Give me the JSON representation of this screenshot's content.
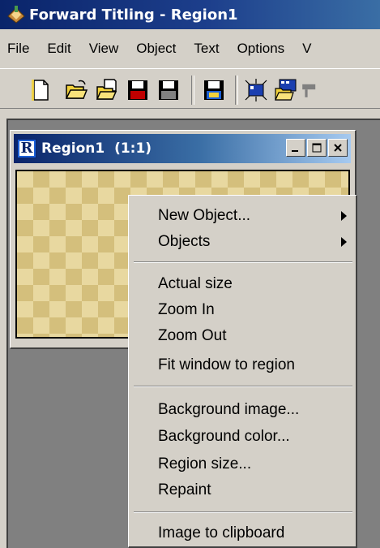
{
  "app": {
    "title": "Forward Titling - Region1"
  },
  "menubar": [
    "File",
    "Edit",
    "View",
    "Object",
    "Text",
    "Options",
    "V"
  ],
  "toolbar": {
    "buttons": [
      "new-icon",
      "open-folder-icon",
      "open-file-icon",
      "save-icon",
      "save-as-icon",
      "save-region-icon",
      "highlight-region-icon",
      "edit-region-icon",
      "more-icon"
    ]
  },
  "region_window": {
    "title": "Region1  (1:1)",
    "icon_letter": "R"
  },
  "context_menu": {
    "items": [
      {
        "label": "New Object...",
        "submenu": true
      },
      {
        "label": "Objects",
        "submenu": true
      },
      {
        "label": "Actual size"
      },
      {
        "label": "Zoom In"
      },
      {
        "label": "Zoom Out"
      },
      {
        "label": "Fit window to region"
      },
      {
        "label": "Background image..."
      },
      {
        "label": "Background color..."
      },
      {
        "label": "Region size..."
      },
      {
        "label": "Repaint"
      },
      {
        "label": "Image to clipboard"
      }
    ]
  },
  "colors": {
    "titlebar": "#0a246a",
    "canvas_light": "#e8d8a0",
    "canvas_dark": "#d4bf7c",
    "face": "#d4d0c8"
  }
}
